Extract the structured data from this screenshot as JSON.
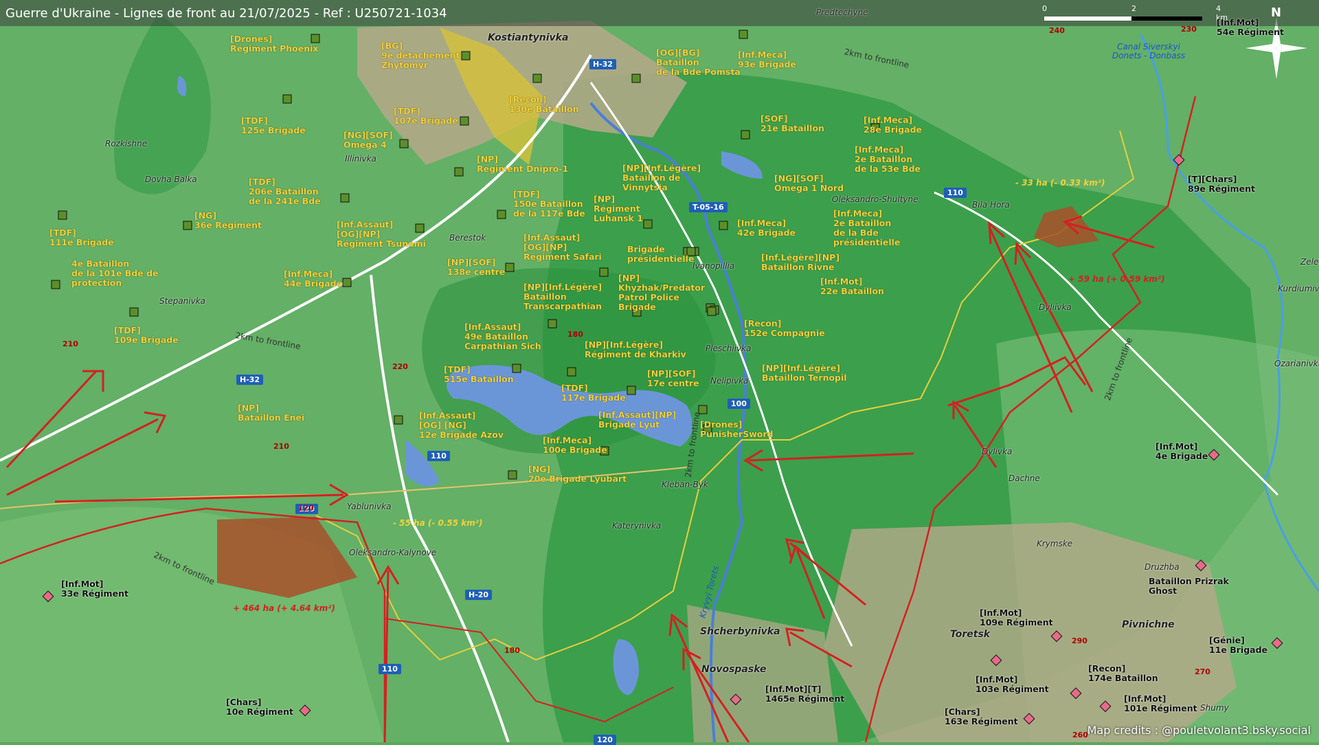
{
  "header": {
    "title": "Guerre d'Ukraine - Lignes de front au 21/07/2025 - Ref : U250721-1034"
  },
  "scale": {
    "labels": [
      "0",
      "2",
      "4 km"
    ]
  },
  "north_label": "N",
  "credits": "Map credits : @pouletvolant3.bsky.social",
  "colors": {
    "ua_label": "#f2d13a",
    "ru_red": "#d42020",
    "ru_gain_fill": "#a8502a",
    "green_dark": "#2a8f3c",
    "green_light": "#7cc07a",
    "water": "#6a96d8"
  },
  "places": [
    {
      "name": "Kostiantynivka",
      "big": true
    },
    {
      "name": "Predtechyne"
    },
    {
      "name": "Rozkishne"
    },
    {
      "name": "Dovha Balka"
    },
    {
      "name": "Illinivka"
    },
    {
      "name": "Stepanivka"
    },
    {
      "name": "Berestok"
    },
    {
      "name": "Ivanopillia"
    },
    {
      "name": "Pleschiivka"
    },
    {
      "name": "Nelipivka"
    },
    {
      "name": "Oleksandro-Shultyne"
    },
    {
      "name": "Bila Hora"
    },
    {
      "name": "Dyliivka"
    },
    {
      "name": "Dylivka"
    },
    {
      "name": "Dachne"
    },
    {
      "name": "Krymske"
    },
    {
      "name": "Druzhba"
    },
    {
      "name": "Kurdiumivka"
    },
    {
      "name": "Ozarianivka"
    },
    {
      "name": "Zele"
    },
    {
      "name": "Kleban-Byk"
    },
    {
      "name": "Katerynivka"
    },
    {
      "name": "Yablunivka"
    },
    {
      "name": "Oleksandro-Kalynove"
    },
    {
      "name": "Shcherbynivka",
      "big": true
    },
    {
      "name": "Novospaske",
      "big": true
    },
    {
      "name": "Toretsk",
      "big": true
    },
    {
      "name": "Pivnichne",
      "big": true
    },
    {
      "name": "Shumy"
    }
  ],
  "water_labels": [
    {
      "text": "Canal Siverskyi Donets - Donbass"
    },
    {
      "text": "Kryvyi Torets"
    }
  ],
  "front_labels": [
    "2km to frontline",
    "2km to frontline",
    "2km to frontline",
    "2km to frontline",
    "2km to frontline"
  ],
  "roads": [
    "H-32",
    "H-32",
    "H-20",
    "T-05-16",
    "110",
    "110",
    "110",
    "120",
    "120",
    "100"
  ],
  "elevations": [
    "240",
    "230",
    "210",
    "210",
    "220",
    "180",
    "180",
    "290",
    "270",
    "260",
    "120"
  ],
  "areas": [
    {
      "text": "- 33 ha (- 0.33 km²)",
      "kind": "loss"
    },
    {
      "text": "+ 59 ha (+ 0.59 km²)",
      "kind": "gain"
    },
    {
      "text": "- 55 ha (- 0.55 km²)",
      "kind": "loss"
    },
    {
      "text": "+ 464 ha (+ 4.64 km²)",
      "kind": "gain"
    }
  ],
  "ua_units": [
    {
      "line1": "[Drones]",
      "line2": "Régiment Phoenix"
    },
    {
      "line1": "[BG]",
      "line2": "9e détachement",
      "line3": "Zhytomyr"
    },
    {
      "line1": "[Recon]",
      "line2": "130e Bataillon"
    },
    {
      "line1": "[TDF]",
      "line2": "107e Brigade"
    },
    {
      "line1": "[TDF]",
      "line2": "125e Brigade"
    },
    {
      "line1": "[NG][SOF]",
      "line2": "Omega 4"
    },
    {
      "line1": "[NP]",
      "line2": "Régiment Dnipro-1"
    },
    {
      "line1": "[TDF]",
      "line2": "206e Bataillon",
      "line3": "de la 241e Bde"
    },
    {
      "line1": "[NG]",
      "line2": "36e Régiment"
    },
    {
      "line1": "[TDF]",
      "line2": "111e Brigade"
    },
    {
      "line1": "[Inf.Assaut]",
      "line2": "[OG][NP]",
      "line3": "Régiment Tsunami"
    },
    {
      "line1": "4e Bataillon",
      "line2": "de la 101e Bde de",
      "line3": "protection"
    },
    {
      "line1": "[Inf.Meca]",
      "line2": "44e Brigade"
    },
    {
      "line1": "[TDF]",
      "line2": "109e Brigade"
    },
    {
      "line1": "[TDF]",
      "line2": "150e Bataillon",
      "line3": "de la 117e Bde"
    },
    {
      "line1": "[NP]",
      "line2": "Régiment",
      "line3": "Luhansk 1"
    },
    {
      "line1": "[Inf.Assaut]",
      "line2": "[OG][NP]",
      "line3": "Régiment Safari"
    },
    {
      "line1": "[NP][SOF]",
      "line2": "138e centre"
    },
    {
      "line1": "[NP][Inf.Légère]",
      "line2": "Bataillon",
      "line3": "Transcarpathian"
    },
    {
      "line1": "[Inf.Assaut]",
      "line2": "49e Bataillon",
      "line3": "Carpathian Sich"
    },
    {
      "line1": "[TDF]",
      "line2": "515e Bataillon"
    },
    {
      "line1": "[NP]",
      "line2": "Bataillon Enei"
    },
    {
      "line1": "[Inf.Assaut]",
      "line2": "[OG] [NG]",
      "line3": "12e Brigade Azov"
    },
    {
      "line1": "[TDF]",
      "line2": "117e Brigade"
    },
    {
      "line1": "[Inf.Meca]",
      "line2": "100e Brigade"
    },
    {
      "line1": "[NG]",
      "line2": "20e Brigade Lyubart"
    },
    {
      "line1": "[Inf.Assaut][NP]",
      "line2": "Brigade Lyut"
    },
    {
      "line1": "[NP][SOF]",
      "line2": "17e centre"
    },
    {
      "line1": "[Drones]",
      "line2": "PunisherSword"
    },
    {
      "line1": "[NP][Inf.Légère]",
      "line2": "Régiment de Kharkiv"
    },
    {
      "line1": "[NP][Inf.Légère]",
      "line2": "Bataillon Ternopil"
    },
    {
      "line1": "[Recon]",
      "line2": "152e Compagnie"
    },
    {
      "line1": "[NP]",
      "line2": "Khyzhak/Predator",
      "line3": "Patrol Police",
      "line4": "Brigade"
    },
    {
      "line1": "Brigade",
      "line2": "présidentielle"
    },
    {
      "line1": "[NP][Inf.Légère]",
      "line2": "Bataillon de",
      "line3": "Vinnytsia"
    },
    {
      "line1": "[OG][BG]",
      "line2": "Bataillon",
      "line3": "de la Bde Pomsta"
    },
    {
      "line1": "[Inf.Meca]",
      "line2": "93e Brigade"
    },
    {
      "line1": "[SOF]",
      "line2": "21e Bataillon"
    },
    {
      "line1": "[Inf.Meca]",
      "line2": "28e Brigade"
    },
    {
      "line1": "[Inf.Meca]",
      "line2": "2e Bataillon",
      "line3": "de la 53e Bde"
    },
    {
      "line1": "[NG][SOF]",
      "line2": "Omega 1 Nord"
    },
    {
      "line1": "[Inf.Meca]",
      "line2": "42e Brigade"
    },
    {
      "line1": "[Inf.Meca]",
      "line2": "2e Bataillon",
      "line3": "de la Bde",
      "line4": "présidentielle"
    },
    {
      "line1": "[Inf.Légère][NP]",
      "line2": "Bataillon Rivne"
    },
    {
      "line1": "[Inf.Mot]",
      "line2": "22e Bataillon"
    }
  ],
  "ru_units": [
    {
      "line1": "[Inf.Mot]",
      "line2": "54e Régiment"
    },
    {
      "line1": "[T][Chars]",
      "line2": "89e Régiment"
    },
    {
      "line1": "[Inf.Mot]",
      "line2": "4e Brigade"
    },
    {
      "line1": "[Inf.Mot]",
      "line2": "33e Régiment"
    },
    {
      "line1": "[Chars]",
      "line2": "10e Régiment"
    },
    {
      "line1": "[Inf.Mot][T]",
      "line2": "1465e Régiment"
    },
    {
      "line1": "[Inf.Mot]",
      "line2": "109e Régiment"
    },
    {
      "line1": "[Inf.Mot]",
      "line2": "103e Régiment"
    },
    {
      "line1": "[Recon]",
      "line2": "174e Bataillon"
    },
    {
      "line1": "[Inf.Mot]",
      "line2": "101e Régiment"
    },
    {
      "line1": "[Chars]",
      "line2": "163e Régiment"
    },
    {
      "line1": "Bataillon Prizrak",
      "line2": "Ghost"
    },
    {
      "line1": "[Génie]",
      "line2": "11e Brigade"
    }
  ]
}
